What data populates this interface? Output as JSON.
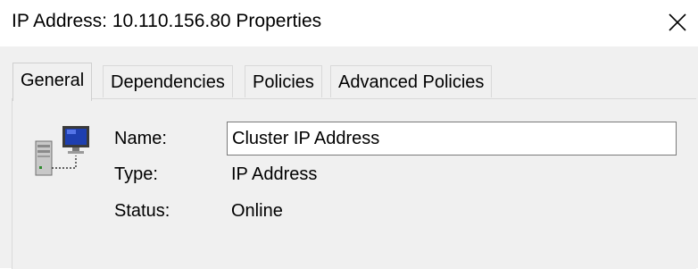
{
  "window": {
    "title": "IP Address: 10.110.156.80 Properties",
    "close_glyph": "✕",
    "close_icon": "close-icon"
  },
  "tabs": [
    {
      "label": "General",
      "active": true
    },
    {
      "label": "Dependencies",
      "active": false
    },
    {
      "label": "Policies",
      "active": false
    },
    {
      "label": "Advanced Policies",
      "active": false
    }
  ],
  "general": {
    "resource_icon": "ip-address-resource-icon",
    "name_label": "Name:",
    "name_value": "Cluster IP Address",
    "type_label": "Type:",
    "type_value": "IP Address",
    "status_label": "Status:",
    "status_value": "Online"
  },
  "colors": {
    "client_background": "#f0f0f0",
    "input_background": "#ffffff",
    "monitor_screen": "#1e3fb0"
  }
}
